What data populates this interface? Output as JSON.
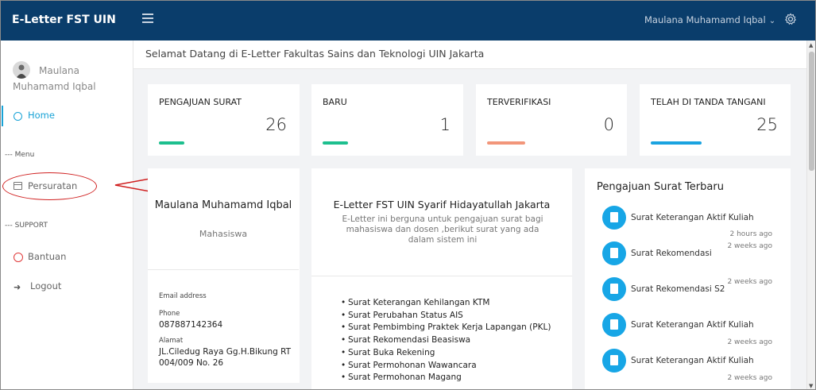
{
  "app": {
    "brand": "E-Letter FST UIN"
  },
  "topbar": {
    "user_name": "Maulana Muhamamd Iqbal",
    "chevron": "⌄",
    "menu_icon": "hamburger-icon",
    "settings_icon": "gear-icon"
  },
  "sidebar": {
    "profile_name": "Maulana Muhamamd Iqbal",
    "home_label": "Home",
    "menu_section": "--- Menu",
    "persuratan_label": "Persuratan",
    "support_section": "--- SUPPORT",
    "bantuan_label": "Bantuan",
    "logout_label": "Logout"
  },
  "header": {
    "welcome": "Selamat Datang di E-Letter Fakultas Sains dan Teknologi UIN Jakarta"
  },
  "stats": [
    {
      "label": "PENGAJUAN SURAT",
      "value": "26",
      "color": "#1dbf8e"
    },
    {
      "label": "BARU",
      "value": "1",
      "color": "#1dbf8e"
    },
    {
      "label": "TERVERIFIKASI",
      "value": "0",
      "color": "#f2967a"
    },
    {
      "label": "TELAH DI TANDA TANGANI",
      "value": "25",
      "color": "#1aa3e0"
    }
  ],
  "profile_card": {
    "name": "Maulana Muhamamd Iqbal",
    "role": "Mahasiswa",
    "email_label": "Email address",
    "phone_label": "Phone",
    "phone": "087887142364",
    "address_label": "Alamat",
    "address": "JL.Ciledug Raya Gg.H.Bikung RT 004/009 No. 26"
  },
  "info_card": {
    "title": "E-Letter FST UIN Syarif Hidayatullah Jakarta",
    "description": "E-Letter ini berguna untuk pengajuan surat bagi mahasiswa dan dosen ,berikut surat yang ada dalam sistem ini",
    "items": [
      "Surat Keterangan Kehilangan KTM",
      "Surat Perubahan Status AIS",
      "Surat Pembimbing Praktek Kerja Lapangan (PKL)",
      "Surat Rekomendasi Beasiswa",
      "Surat Buka Rekening",
      "Surat Permohonan Wawancara",
      "Surat Permohonan Magang"
    ]
  },
  "latest": {
    "title": "Pengajuan Surat Terbaru",
    "items": [
      {
        "name": "Surat Keterangan Aktif Kuliah",
        "time": "2 hours ago"
      },
      {
        "name": "Surat Rekomendasi",
        "time": "2 weeks ago"
      },
      {
        "name": "Surat Rekomendasi S2",
        "time": "2 weeks ago"
      },
      {
        "name": "Surat Keterangan Aktif Kuliah",
        "time": "2 weeks ago"
      },
      {
        "name": "Surat Keterangan Aktif Kuliah",
        "time": "2 weeks ago"
      }
    ]
  },
  "annotation": {
    "color": "#d02020"
  }
}
